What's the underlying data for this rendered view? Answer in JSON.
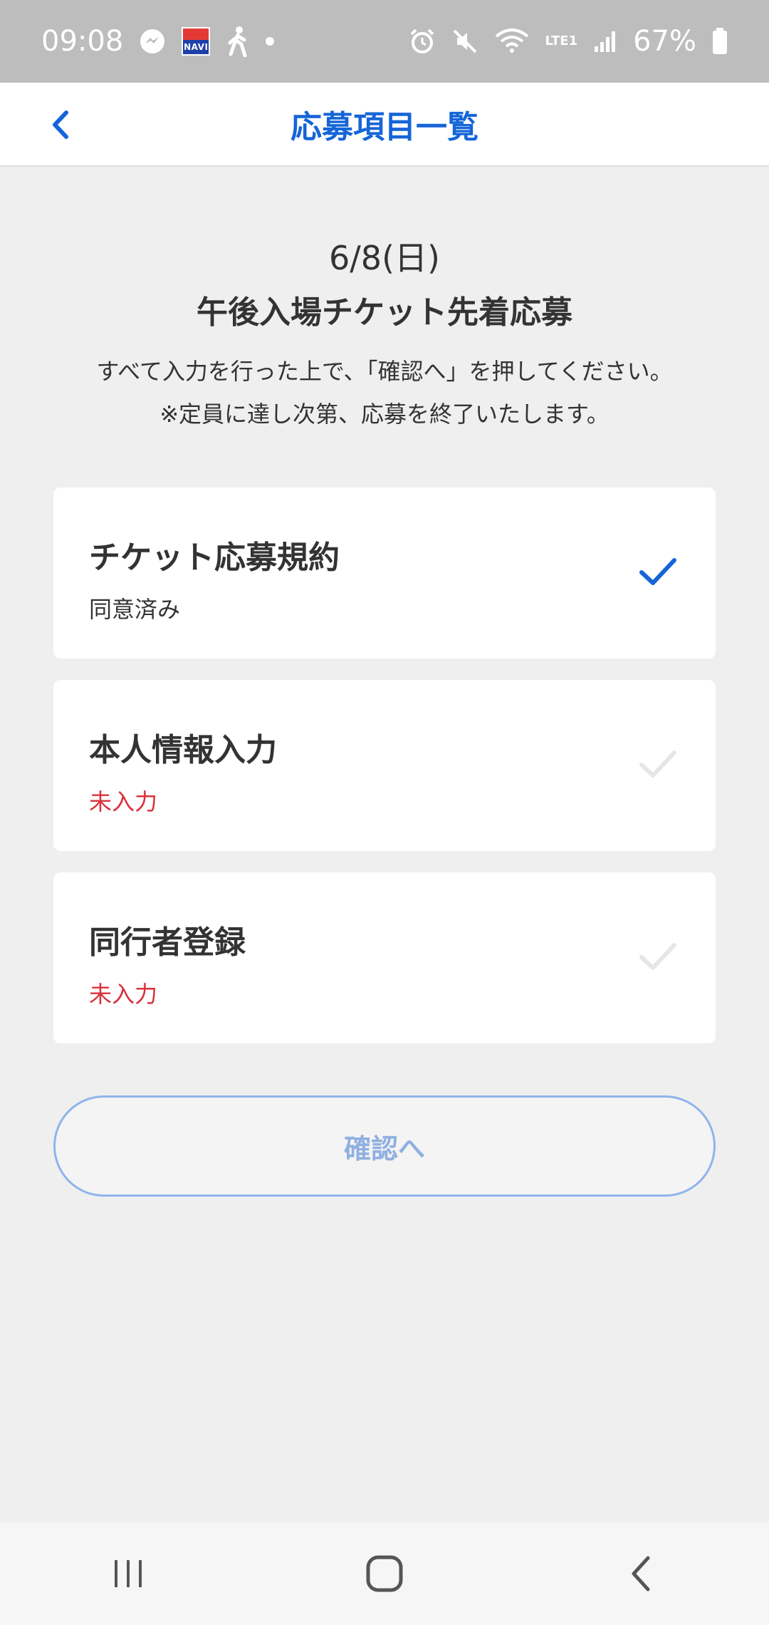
{
  "status_bar": {
    "time": "09:08",
    "battery": "67%",
    "network": "LTE1",
    "navi_label": "NAVI"
  },
  "header": {
    "title": "応募項目一覧"
  },
  "event": {
    "date": "6/8(日)",
    "title": "午後入場チケット先着応募",
    "instruction": "すべて入力を行った上で、「確認へ」を押してください。",
    "notice": "※定員に達し次第、応募を終了いたします。"
  },
  "items": [
    {
      "title": "チケット応募規約",
      "status": "同意済み",
      "completed": true
    },
    {
      "title": "本人情報入力",
      "status": "未入力",
      "completed": false
    },
    {
      "title": "同行者登録",
      "status": "未入力",
      "completed": false
    }
  ],
  "confirm_button": {
    "label": "確認へ"
  },
  "colors": {
    "accent": "#1565d8",
    "pending": "#d8323c",
    "check_done": "#1565d8",
    "check_pending": "#e6e6e6"
  }
}
